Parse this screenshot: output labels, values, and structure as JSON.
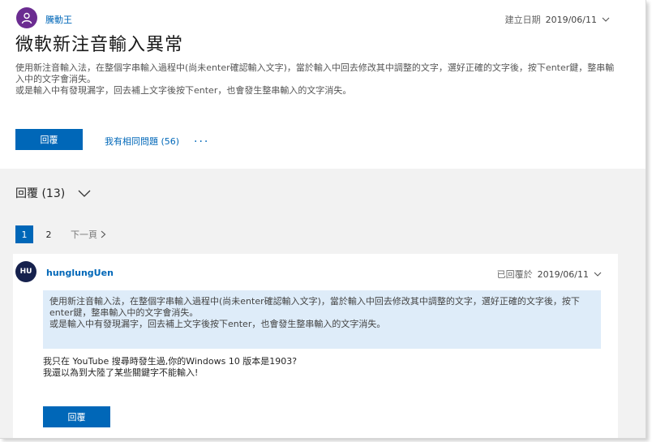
{
  "question": {
    "author": "騰動王",
    "created_label": "建立日期",
    "created_date": "2019/06/11",
    "title": "微軟新注音輸入異常",
    "body_line1": "使用新注音輸入法，在整個字串輸入過程中(尚未enter確認輸入文字)，當於輸入中回去修改其中調整的文字，選好正確的文字後，按下enter鍵，整串輸入中的文字會消失。",
    "body_line2": "或是輸入中有發現漏字，回去補上文字後按下enter，也會發生整串輸入的文字消失。",
    "reply_button": "回覆",
    "same_question": "我有相同問題 (56)",
    "more": "..."
  },
  "replies": {
    "header": "回覆 (13)",
    "pager": {
      "page1": "1",
      "page2": "2",
      "next": "下一頁"
    },
    "reply1": {
      "avatar_initials": "HU",
      "author": "hunglungUen",
      "replied_label": "已回覆於",
      "replied_date": "2019/06/11",
      "quote_line1": "使用新注音輸入法，在整個字串輸入過程中(尚未enter確認輸入文字)，當於輸入中回去修改其中調整的文字，選好正確的文字後，按下enter鍵，整串輸入中的文字會消失。",
      "quote_line2": "或是輸入中有發現漏字，回去補上文字後按下enter，也會發生整串輸入的文字消失。",
      "body_line1": "我只在 YouTube 搜尋時發生過,你的Windows 10 版本是1903?",
      "body_line2": "我還以為到大陸了某些關鍵字不能輸入!",
      "reply_button": "回覆"
    }
  },
  "colors": {
    "accent": "#0067b8",
    "quote_bg": "#deecf9",
    "avatar_q": "#6b2c91",
    "avatar_r": "#16214d"
  },
  "icons": {
    "avatar": "person-icon",
    "expand": "chevron-down-icon",
    "next": "chevron-right-icon"
  }
}
